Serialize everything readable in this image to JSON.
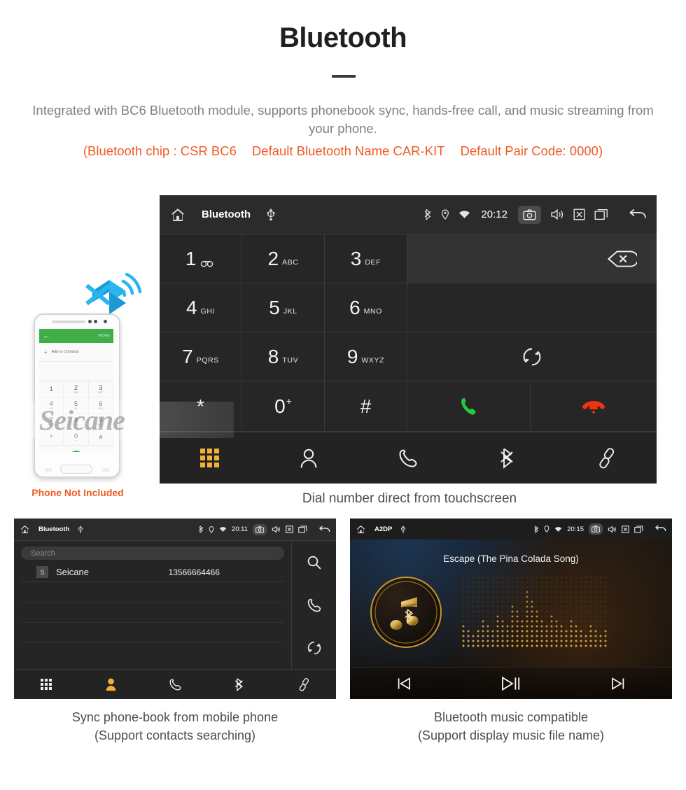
{
  "header": {
    "title": "Bluetooth",
    "description": "Integrated with BC6 Bluetooth module, supports phonebook sync, hands-free call, and music streaming from your phone.",
    "spec_chip": "(Bluetooth chip : CSR BC6",
    "spec_name": "Default Bluetooth Name CAR-KIT",
    "spec_pair": "Default Pair Code: 0000)",
    "accent_color": "#f15a24",
    "text_color": "#808080"
  },
  "dialer": {
    "statusbar": {
      "home_icon": "home-icon",
      "title": "Bluetooth",
      "usb_icon": "usb-icon",
      "bluetooth_icon": "bluetooth-icon",
      "location_icon": "location-icon",
      "wifi_icon": "wifi-icon",
      "time": "20:12",
      "camera_icon": "camera-icon",
      "volume_icon": "volume-icon",
      "close_icon": "close-box-icon",
      "recents_icon": "recents-icon",
      "back_icon": "back-arrow-icon"
    },
    "number_input": {
      "value": "",
      "backspace_icon": "backspace-icon"
    },
    "keys": [
      {
        "digit": "1",
        "sub": "",
        "voicemail": true
      },
      {
        "digit": "2",
        "sub": "ABC"
      },
      {
        "digit": "3",
        "sub": "DEF"
      },
      {
        "digit": "4",
        "sub": "GHI"
      },
      {
        "digit": "5",
        "sub": "JKL"
      },
      {
        "digit": "6",
        "sub": "MNO"
      },
      {
        "digit": "7",
        "sub": "PQRS"
      },
      {
        "digit": "8",
        "sub": "TUV"
      },
      {
        "digit": "9",
        "sub": "WXYZ"
      },
      {
        "digit": "*",
        "sub": ""
      },
      {
        "digit": "0",
        "sub": "",
        "plus": "+"
      },
      {
        "digit": "#",
        "sub": ""
      }
    ],
    "sync_icon": "sync-icon",
    "call_icon": "call-answer-icon",
    "hangup_icon": "call-end-icon",
    "call_color": "#27c83c",
    "hangup_color": "#f0330e",
    "navbar": [
      {
        "icon": "dialpad-icon",
        "label": "Dialpad",
        "active": true
      },
      {
        "icon": "contacts-icon",
        "label": "Contacts",
        "active": false
      },
      {
        "icon": "call-log-icon",
        "label": "Call log",
        "active": false
      },
      {
        "icon": "bluetooth-icon",
        "label": "Bluetooth",
        "active": false
      },
      {
        "icon": "link-icon",
        "label": "Pair",
        "active": false
      }
    ],
    "active_color": "#f2b036"
  },
  "phone_mock": {
    "bt_wave_icon": "bluetooth-signal-icon",
    "screen": {
      "back_icon": "back-arrow-icon",
      "more_label": "MORE",
      "add_label": "Add to Contacts",
      "add_icon": "plus-icon",
      "keys": [
        {
          "digit": "1",
          "sub": ""
        },
        {
          "digit": "2",
          "sub": "ABC"
        },
        {
          "digit": "3",
          "sub": "DEF"
        },
        {
          "digit": "4",
          "sub": "GHI"
        },
        {
          "digit": "5",
          "sub": "JKL"
        },
        {
          "digit": "6",
          "sub": "MNO"
        },
        {
          "digit": "7",
          "sub": "PQRS"
        },
        {
          "digit": "8",
          "sub": "TUV"
        },
        {
          "digit": "9",
          "sub": "WXYZ"
        },
        {
          "digit": "*",
          "sub": ""
        },
        {
          "digit": "0",
          "sub": "+"
        },
        {
          "digit": "#",
          "sub": ""
        }
      ],
      "call_icon": "call-answer-icon",
      "video_icon": "video-call-icon",
      "keyboard_icon": "keyboard-icon",
      "bar_color": "#3fae49"
    },
    "disclaimer": "Phone Not Included"
  },
  "captions": {
    "main": "Dial number direct from touchscreen",
    "left_line1": "Sync phone-book from mobile phone",
    "left_line2": "(Support contacts searching)",
    "right_line1": "Bluetooth music compatible",
    "right_line2": "(Support display music file name)"
  },
  "watermark": {
    "text": "Seicane"
  },
  "phonebook": {
    "statusbar": {
      "home_icon": "home-icon",
      "title": "Bluetooth",
      "usb_icon": "usb-icon",
      "time": "20:11",
      "camera_icon": "camera-icon",
      "volume_icon": "volume-icon",
      "close_icon": "close-box-icon",
      "recents_icon": "recents-icon",
      "back_icon": "back-arrow-icon"
    },
    "search": {
      "placeholder": "Search",
      "value": ""
    },
    "contacts": [
      {
        "initial": "S",
        "name": "Seicane",
        "number": "13566664466"
      }
    ],
    "empty_rows": 3,
    "side_actions": [
      {
        "icon": "search-icon",
        "label": "Search"
      },
      {
        "icon": "call-log-icon",
        "label": "Call"
      },
      {
        "icon": "sync-icon",
        "label": "Sync"
      }
    ],
    "navbar": [
      {
        "icon": "dialpad-icon",
        "label": "Dialpad",
        "active": false
      },
      {
        "icon": "contacts-icon",
        "label": "Contacts",
        "active": true
      },
      {
        "icon": "call-log-icon",
        "label": "Call log",
        "active": false
      },
      {
        "icon": "bluetooth-icon",
        "label": "Bluetooth",
        "active": false
      },
      {
        "icon": "link-icon",
        "label": "Pair",
        "active": false
      }
    ],
    "active_color": "#f2b036"
  },
  "a2dp": {
    "statusbar": {
      "home_icon": "home-icon",
      "title": "A2DP",
      "usb_icon": "usb-icon",
      "time": "20:15",
      "camera_icon": "camera-icon",
      "volume_icon": "volume-icon",
      "close_icon": "close-box-icon",
      "recents_icon": "recents-icon",
      "back_icon": "back-arrow-icon"
    },
    "song_title": "Escape (The Pina Colada Song)",
    "album_art_icon": "music-bluetooth-icon",
    "equalizer_icon": "equalizer-dots",
    "controls": [
      {
        "icon": "previous-track-icon",
        "label": "Previous"
      },
      {
        "icon": "play-pause-icon",
        "label": "Play / Pause"
      },
      {
        "icon": "next-track-icon",
        "label": "Next"
      }
    ],
    "gold_color": "#c9952c"
  }
}
